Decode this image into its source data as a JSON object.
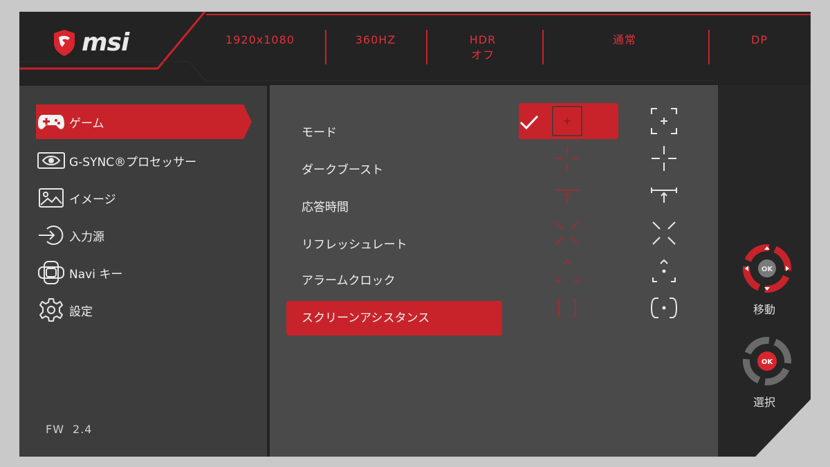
{
  "brand": {
    "name": "msi"
  },
  "status_bar": [
    {
      "id": "resolution",
      "lines": [
        "1920x1080"
      ]
    },
    {
      "id": "refresh",
      "lines": [
        "360HZ"
      ]
    },
    {
      "id": "hdr",
      "lines": [
        "HDR",
        "オフ"
      ]
    },
    {
      "id": "mode",
      "lines": [
        "通常"
      ]
    },
    {
      "id": "input",
      "lines": [
        "DP"
      ]
    }
  ],
  "left_menu": [
    {
      "label": "ゲーム",
      "icon": "gamepad-icon",
      "active": true
    },
    {
      "label": "G-SYNC®プロセッサー",
      "icon": "nvidia-icon",
      "active": false
    },
    {
      "label": "イメージ",
      "icon": "image-icon",
      "active": false
    },
    {
      "label": "入力源",
      "icon": "input-source-icon",
      "active": false
    },
    {
      "label": "Navi キー",
      "icon": "navi-key-icon",
      "active": false
    },
    {
      "label": "設定",
      "icon": "gear-icon",
      "active": false
    }
  ],
  "sub_menu": [
    {
      "label": "モード",
      "active": false
    },
    {
      "label": "ダークブースト",
      "active": false
    },
    {
      "label": "応答時間",
      "active": false
    },
    {
      "label": "リフレッシュレート",
      "active": false
    },
    {
      "label": "アラームクロック",
      "active": false
    },
    {
      "label": "スクリーンアシスタンス",
      "active": true
    }
  ],
  "crosshairs": [
    {
      "name": "bracket-plus-crosshair-icon",
      "selected": true
    },
    {
      "name": "split-cross-crosshair-icon",
      "selected": false
    },
    {
      "name": "arrow-crosshair-icon",
      "selected": false
    },
    {
      "name": "x-crosshair-icon",
      "selected": false
    },
    {
      "name": "triangle-crosshair-icon",
      "selected": false
    },
    {
      "name": "circle-dot-crosshair-icon",
      "selected": false
    }
  ],
  "controls": {
    "move_label": "移動",
    "select_label": "選択",
    "ok_label": "OK"
  },
  "firmware": {
    "label": "FW",
    "version": "2.4"
  },
  "colors": {
    "accent": "#c8232b",
    "status_text": "#e0323a",
    "background": "#232323"
  }
}
